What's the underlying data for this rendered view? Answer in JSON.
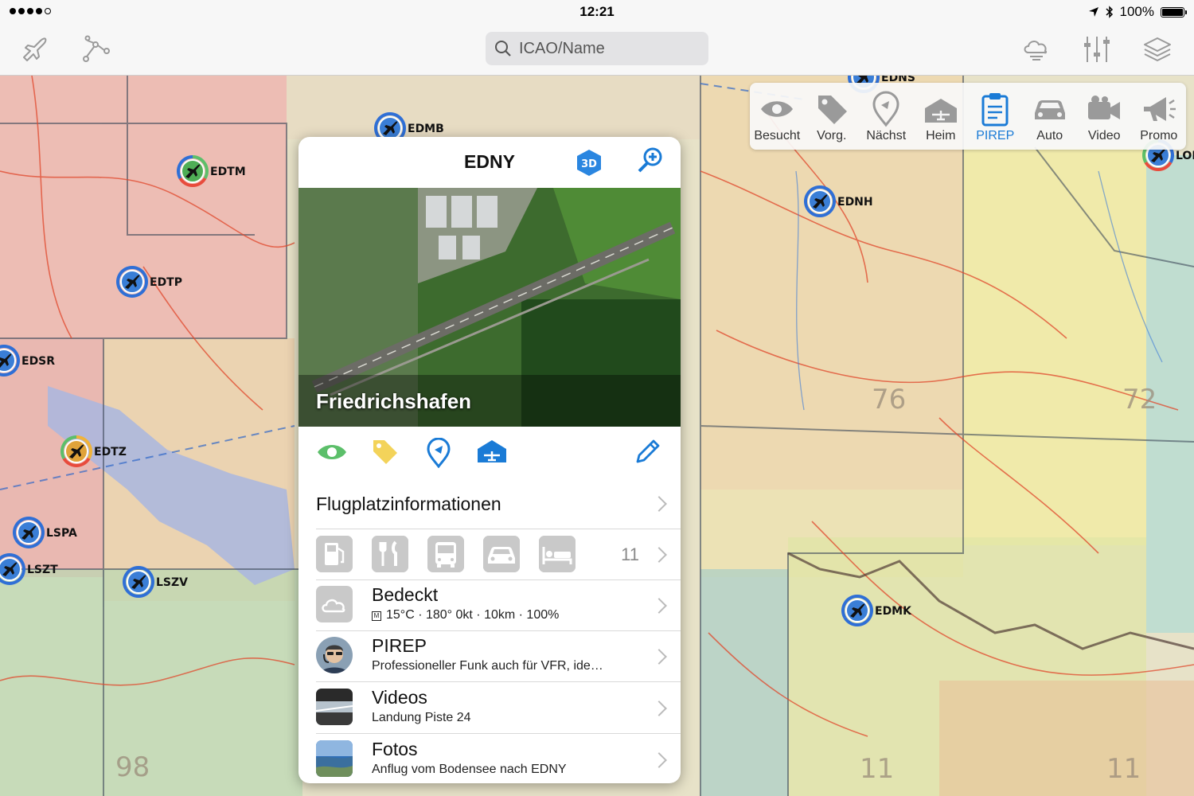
{
  "status_bar": {
    "time": "12:21",
    "battery": "100%",
    "battery_level": 1.0
  },
  "nav": {
    "search_placeholder": "ICAO/Name"
  },
  "toolbar": {
    "items": [
      {
        "label": "Besucht",
        "icon": "eye-icon"
      },
      {
        "label": "Vorg.",
        "icon": "tag-icon"
      },
      {
        "label": "Nächst",
        "icon": "location-pin-icon"
      },
      {
        "label": "Heim",
        "icon": "hangar-icon"
      },
      {
        "label": "PIREP",
        "icon": "clipboard-icon",
        "active": true
      },
      {
        "label": "Auto",
        "icon": "car-icon"
      },
      {
        "label": "Video",
        "icon": "video-camera-icon"
      },
      {
        "label": "Promo",
        "icon": "megaphone-icon"
      }
    ]
  },
  "map": {
    "airports": [
      {
        "code": "EDTM"
      },
      {
        "code": "EDTP"
      },
      {
        "code": "EDSR"
      },
      {
        "code": "EDTZ"
      },
      {
        "code": "LSPA"
      },
      {
        "code": "LSZT"
      },
      {
        "code": "LSZV"
      },
      {
        "code": "EDMB"
      },
      {
        "code": "EDNH"
      },
      {
        "code": "EDMK"
      },
      {
        "code": "LOIR"
      },
      {
        "code": "EDNS"
      }
    ]
  },
  "popover": {
    "icao": "EDNY",
    "name": "Friedrichshafen",
    "info_label": "Flugplatzinformationen",
    "facilities_count": "11",
    "weather": {
      "title": "Bedeckt",
      "detail": "15°C · 180° 0kt · 10km · 100%"
    },
    "pirep": {
      "title": "PIREP",
      "detail": "Professioneller Funk auch für VFR, ide…"
    },
    "videos": {
      "title": "Videos",
      "detail": "Landung Piste 24"
    },
    "photos": {
      "title": "Fotos",
      "detail": "Anflug vom Bodensee nach EDNY"
    }
  },
  "colors": {
    "accent": "#1a7bd6",
    "visited": "#5cbf6a",
    "tag": "#f3d35a",
    "icon_gray": "#9a9a9a"
  }
}
